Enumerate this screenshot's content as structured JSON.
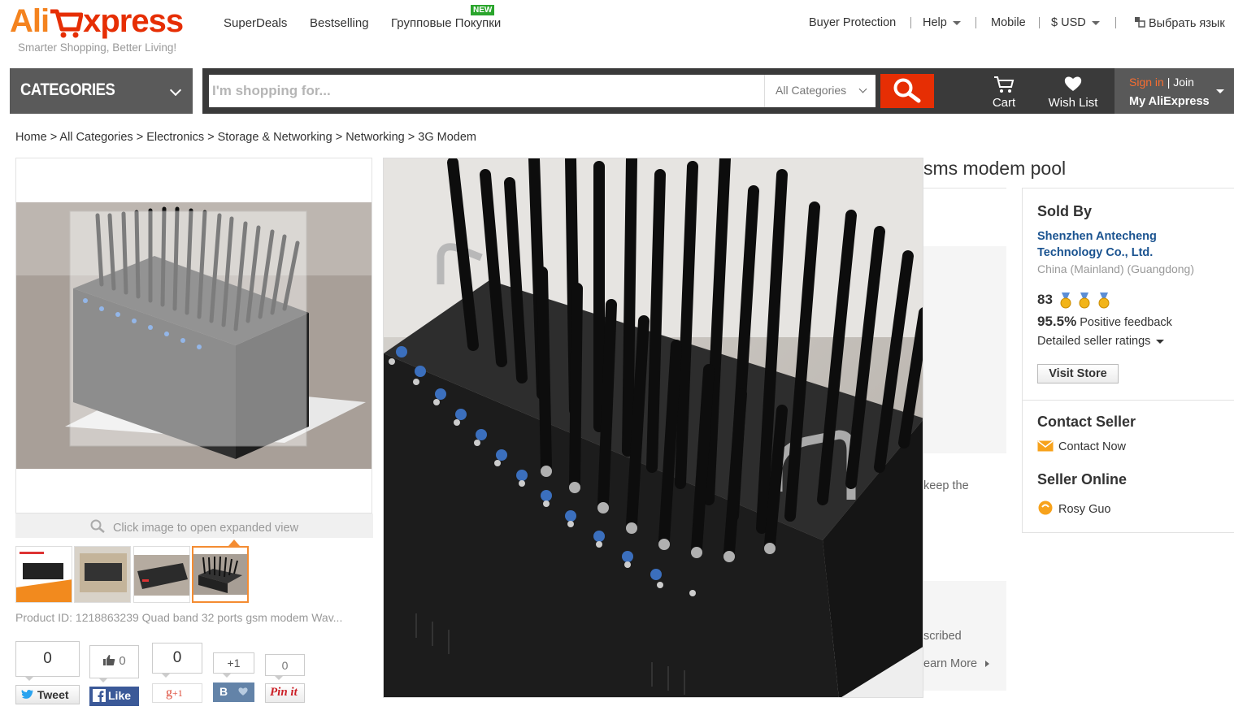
{
  "header": {
    "logo_ali": "Ali",
    "logo_express": "xpress",
    "tagline": "Smarter Shopping, Better Living!",
    "nav": {
      "superdeals": "SuperDeals",
      "bestselling": "Bestselling",
      "group_buy": "Групповые Покупки",
      "new_badge": "NEW"
    },
    "right_nav": {
      "buyer_protection": "Buyer Protection",
      "help": "Help",
      "mobile": "Mobile",
      "currency": "$ USD",
      "language": "Выбрать язык"
    }
  },
  "navbar": {
    "categories_label": "CATEGORIES",
    "search_placeholder": "I'm shopping for...",
    "search_category": "All Categories",
    "cart_label": "Cart",
    "wishlist_label": "Wish List",
    "sign_in": "Sign in",
    "join": "Join",
    "join_sep": "|",
    "my_aliexpress": "My AliExpress"
  },
  "breadcrumb": "Home > All Categories > Electronics > Storage & Networking > Networking > 3G Modem",
  "gallery": {
    "expand_hint": "Click image to open expanded view",
    "thumb_count": 4,
    "active_thumb": 4
  },
  "product": {
    "product_id_line": "Product ID: 1218863239 Quad band 32 ports gsm modem Wav...",
    "title_partial": "sms modem pool",
    "partial_text_1": "keep the",
    "partial_text_2": "scribed",
    "partial_text_3": "earn More"
  },
  "social": {
    "tweet_count": "0",
    "tweet_label": "Tweet",
    "like_count": "0",
    "like_label": "Like",
    "gplus_count": "0",
    "gplus_label": "+1",
    "vk_count": "+1",
    "vk_label": "B",
    "pin_count": "0",
    "pin_label": "Pin it"
  },
  "seller": {
    "sold_by_heading": "Sold By",
    "name_line1": "Shenzhen Antecheng",
    "name_line2": "Technology Co., Ltd.",
    "location": "China (Mainland) (Guangdong)",
    "score": "83",
    "medal_count": 3,
    "feedback_pct": "95.5%",
    "feedback_label": "Positive feedback",
    "detailed_ratings": "Detailed seller ratings",
    "visit_store": "Visit Store",
    "contact_heading": "Contact Seller",
    "contact_now": "Contact Now",
    "online_heading": "Seller Online",
    "online_name": "Rosy Guo"
  },
  "colors": {
    "brand_orange": "#f4831f",
    "brand_red": "#e62e04",
    "link_blue": "#1a5390",
    "nav_dark": "#3a3a3a"
  }
}
